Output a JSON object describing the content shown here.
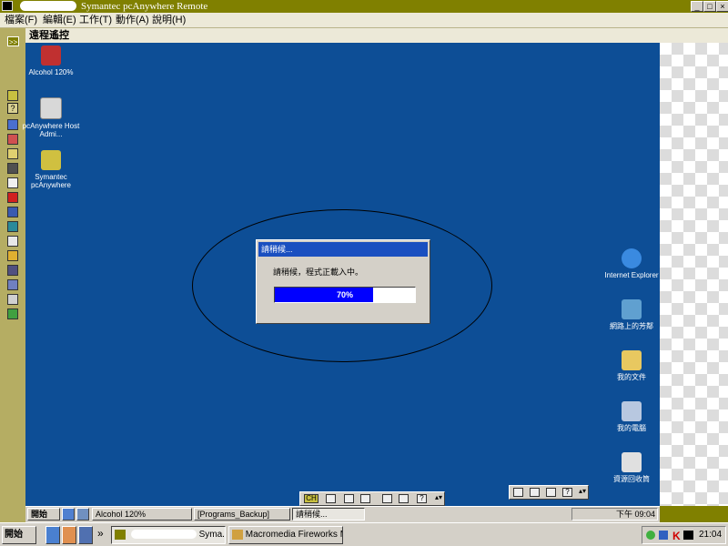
{
  "window": {
    "title": "Symantec pcAnywhere Remote",
    "minimize": "_",
    "maximize": "□",
    "close": "×"
  },
  "menu": [
    {
      "label": "檔案(F)"
    },
    {
      "label": "編輯(E)"
    },
    {
      "label": "工作(T)"
    },
    {
      "label": "動作(A)"
    },
    {
      "label": "說明(H)"
    }
  ],
  "lefttoolbar": {
    "expand": ">>",
    "help": "?"
  },
  "remote_header": "遠程遙控",
  "desktop_icons_left": [
    {
      "label": "Alcohol 120%"
    },
    {
      "label": "pcAnywhere Host Admi..."
    },
    {
      "label": "Symantec pcAnywhere"
    }
  ],
  "desktop_icons_right": [
    {
      "label": "Internet Explorer"
    },
    {
      "label": "網路上的芳鄰"
    },
    {
      "label": "我的文件"
    },
    {
      "label": "我的電腦"
    },
    {
      "label": "資源回收筒"
    }
  ],
  "dialog": {
    "title": "請稍候...",
    "message": "請稍候，程式正載入中。",
    "progress_text": "70%",
    "progress": 0.7
  },
  "remote_taskbar": {
    "start": "開始",
    "buttons": [
      {
        "label": "Alcohol 120%"
      },
      {
        "label": "[Programs_Backup]"
      },
      {
        "label": "請稍候..."
      }
    ],
    "clock": "下午 09:04"
  },
  "float_toolbar": {
    "ch_label": "CH",
    "help": "?",
    "help2": "?"
  },
  "local_taskbar": {
    "start": "開始",
    "chevron": "»",
    "buttons": [
      {
        "label": "Syma..."
      },
      {
        "label": "Macromedia Fireworks M..."
      }
    ],
    "clock": "21:04",
    "tray_badge": "K"
  },
  "colors": {
    "frame": "#808000",
    "desktop": "#0d4e96",
    "dialog_title": "#1a4fc0",
    "progress_fill": "#0000ff"
  }
}
